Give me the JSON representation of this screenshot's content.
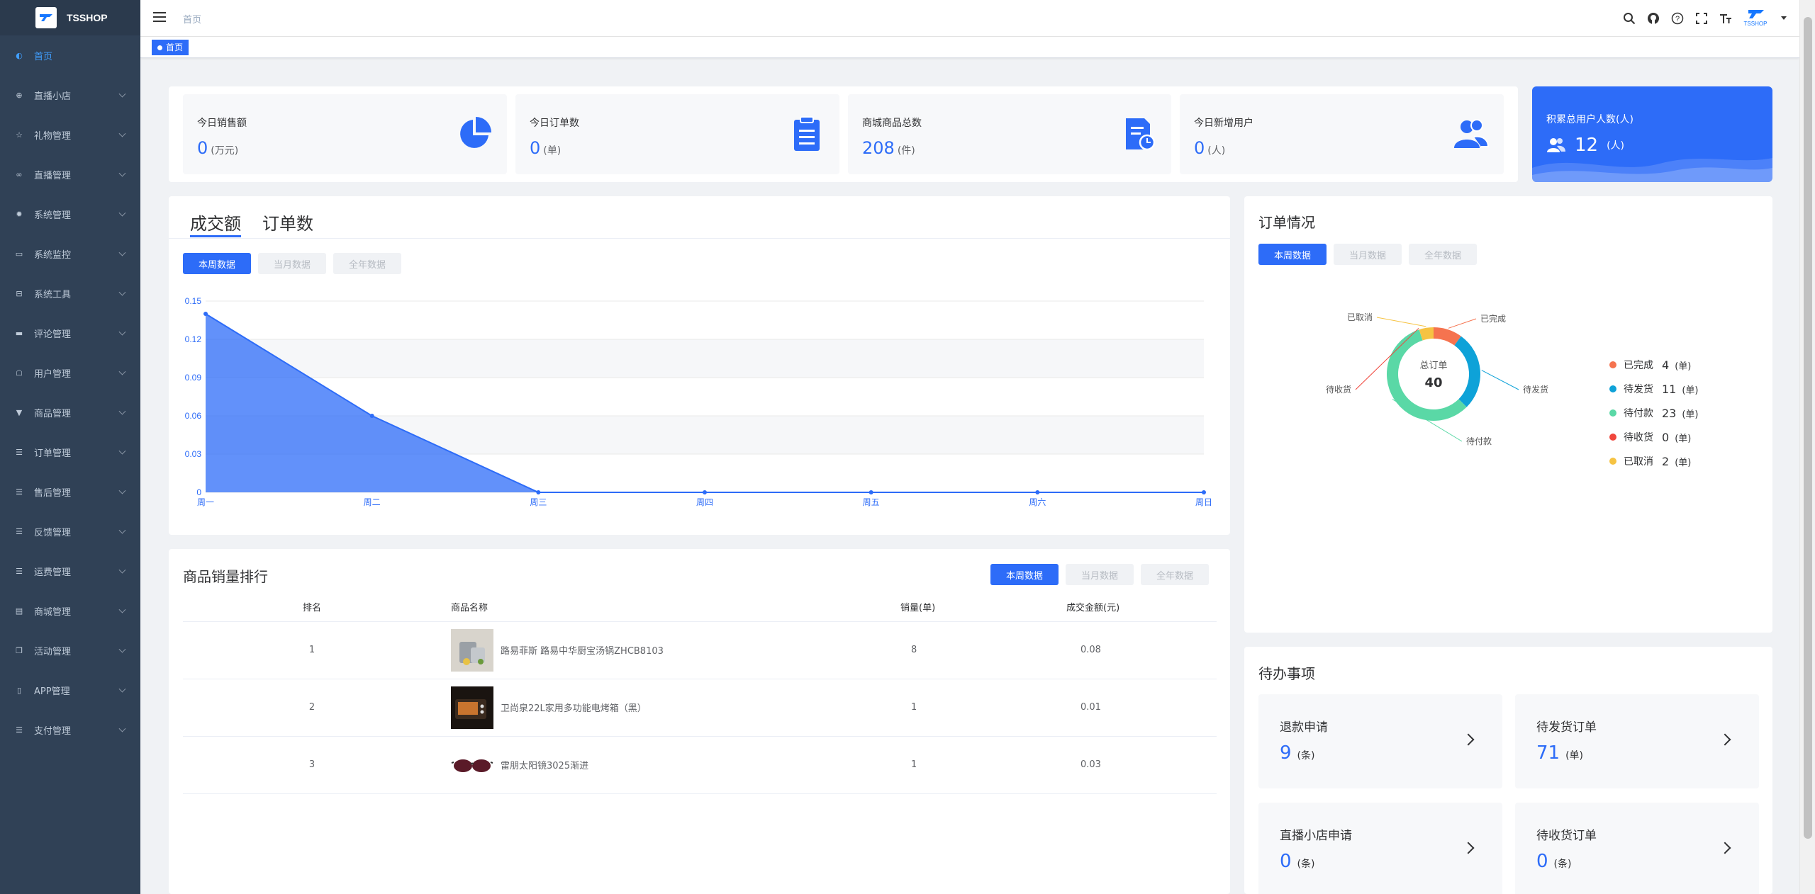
{
  "brand": {
    "name": "TSSHOP",
    "avatar_text": "TSSHOP"
  },
  "sidebar": {
    "items": [
      {
        "label": "首页",
        "icon": "dashboard-icon",
        "active": true
      },
      {
        "label": "直播小店",
        "icon": "shop-icon"
      },
      {
        "label": "礼物管理",
        "icon": "star-icon"
      },
      {
        "label": "直播管理",
        "icon": "link-icon"
      },
      {
        "label": "系统管理",
        "icon": "gear-icon"
      },
      {
        "label": "系统监控",
        "icon": "monitor-icon"
      },
      {
        "label": "系统工具",
        "icon": "toolbox-icon"
      },
      {
        "label": "评论管理",
        "icon": "comment-icon"
      },
      {
        "label": "用户管理",
        "icon": "user-icon"
      },
      {
        "label": "商品管理",
        "icon": "shirt-icon"
      },
      {
        "label": "订单管理",
        "icon": "list-icon"
      },
      {
        "label": "售后管理",
        "icon": "list-icon"
      },
      {
        "label": "反馈管理",
        "icon": "list-icon"
      },
      {
        "label": "运费管理",
        "icon": "list-icon"
      },
      {
        "label": "商城管理",
        "icon": "store-icon"
      },
      {
        "label": "活动管理",
        "icon": "copy-icon"
      },
      {
        "label": "APP管理",
        "icon": "phone-icon"
      },
      {
        "label": "支付管理",
        "icon": "list-icon"
      }
    ]
  },
  "header": {
    "breadcrumb": "首页",
    "tag": "首页"
  },
  "stats": [
    {
      "title": "今日销售额",
      "value": "0",
      "unit": "(万元)",
      "icon": "pie-chart-icon"
    },
    {
      "title": "今日订单数",
      "value": "0",
      "unit": "(单)",
      "icon": "clipboard-icon"
    },
    {
      "title": "商城商品总数",
      "value": "208",
      "unit": "(件)",
      "icon": "document-clock-icon"
    },
    {
      "title": "今日新增用户",
      "value": "0",
      "unit": "(人)",
      "icon": "users-icon"
    }
  ],
  "total_users": {
    "title": "积累总用户人数(人)",
    "value": "12",
    "unit": "(人)"
  },
  "sales_panel": {
    "tabs": [
      "成交额",
      "订单数"
    ],
    "filters": [
      "本周数据",
      "当月数据",
      "全年数据"
    ]
  },
  "orders_panel": {
    "title": "订单情况",
    "filters": [
      "本周数据",
      "当月数据",
      "全年数据"
    ],
    "center_label": "总订单",
    "center_value": "40",
    "legend_unit": "(单)"
  },
  "ranking": {
    "title": "商品销量排行",
    "filters": [
      "本周数据",
      "当月数据",
      "全年数据"
    ],
    "columns": [
      "排名",
      "商品名称",
      "销量(单)",
      "成交金额(元)"
    ],
    "rows": [
      {
        "rank": "1",
        "name": "路易菲斯 路易中华厨宝汤锅ZHCB8103",
        "qty": "8",
        "amount": "0.08"
      },
      {
        "rank": "2",
        "name": "卫尚泉22L家用多功能电烤箱（黑）",
        "qty": "1",
        "amount": "0.01"
      },
      {
        "rank": "3",
        "name": "雷朋太阳镜3025渐进",
        "qty": "1",
        "amount": "0.03"
      }
    ]
  },
  "todo": {
    "title": "待办事项",
    "items": [
      {
        "label": "退款申请",
        "value": "9",
        "unit": "(条)"
      },
      {
        "label": "待发货订单",
        "value": "71",
        "unit": "(单)"
      },
      {
        "label": "直播小店申请",
        "value": "0",
        "unit": "(条)"
      },
      {
        "label": "待收货订单",
        "value": "0",
        "unit": "(条)"
      }
    ]
  },
  "colors": {
    "primary": "#2d6cf8",
    "sidebar": "#304156"
  },
  "chart_data": [
    {
      "type": "area",
      "categories": [
        "周一",
        "周二",
        "周三",
        "周四",
        "周五",
        "周六",
        "周日"
      ],
      "values": [
        0.14,
        0.06,
        0,
        0,
        0,
        0,
        0
      ],
      "ylim": [
        0,
        0.15
      ],
      "yticks": [
        "0",
        "0.03",
        "0.06",
        "0.09",
        "0.12",
        "0.15"
      ],
      "grid": true
    },
    {
      "type": "pie",
      "labels": [
        "已完成",
        "待发货",
        "待付款",
        "待收货",
        "已取消"
      ],
      "values": [
        4,
        11,
        23,
        0,
        2
      ],
      "colors": [
        "#f5734f",
        "#0ea2d8",
        "#5ad8a6",
        "#f0463c",
        "#f6c343"
      ],
      "legend": "right"
    }
  ]
}
